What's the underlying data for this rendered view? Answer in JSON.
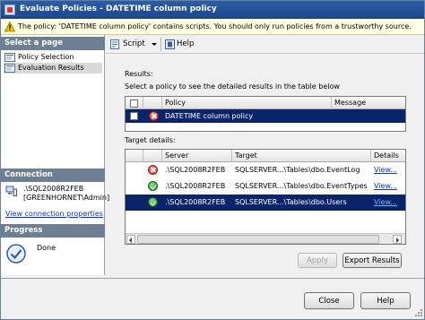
{
  "window": {
    "title": "Evaluate Policies - DATETIME column policy"
  },
  "infobar": {
    "message": "The policy: 'DATETIME column policy' contains scripts. You should only run policies from a trustworthy source."
  },
  "left_pane": {
    "select_page_header": "Select a page",
    "pages": [
      {
        "label": "Policy Selection"
      },
      {
        "label": "Evaluation Results"
      }
    ],
    "connection_header": "Connection",
    "connection_server": ".\\SQL2008R2FEB",
    "connection_user": "[GREENHORNET\\Admin]",
    "connection_link": "View connection properties",
    "progress_header": "Progress",
    "progress_status": "Done"
  },
  "toolbar": {
    "script_label": "Script",
    "help_label": "Help"
  },
  "results": {
    "label": "Results:",
    "instruction": "Select a policy to see the detailed results in the table below",
    "columns": [
      "Policy",
      "Message"
    ],
    "rows": [
      {
        "status": "error",
        "policy": "DATETIME column policy",
        "message": ""
      }
    ]
  },
  "target_details": {
    "label": "Target details:",
    "columns": [
      "Server",
      "Target",
      "Details"
    ],
    "rows": [
      {
        "status": "error",
        "server": ".\\SQL2008R2FEB",
        "target": "SQLSERVER...\\Tables\\dbo.EventLog",
        "details": "View..."
      },
      {
        "status": "ok",
        "server": ".\\SQL2008R2FEB",
        "target": "SQLSERVER...\\Tables\\dbo.EventTypes",
        "details": "View..."
      },
      {
        "status": "ok",
        "server": ".\\SQL2008R2FEB",
        "target": "SQLSERVER...\\Tables\\dbo.Users",
        "details": "View..."
      }
    ]
  },
  "buttons": {
    "apply": "Apply",
    "export": "Export Results",
    "close": "Close",
    "help": "Help"
  },
  "icons": {
    "title": "policy-icon",
    "infobar": "warning-icon",
    "nav": "page-icon",
    "connection": "server-connection-icon",
    "progress": "done-check-icon",
    "script": "script-icon",
    "help": "help-icon",
    "status_error": "error-icon",
    "status_ok": "success-icon"
  },
  "colors": {
    "title_bar": "#1d4687",
    "infobar_bg": "#ffffe1",
    "selection": "#0a246a",
    "section_header": "#6e7f93",
    "link": "#0033cc",
    "error": "#c62828",
    "success": "#2e8b2e"
  }
}
